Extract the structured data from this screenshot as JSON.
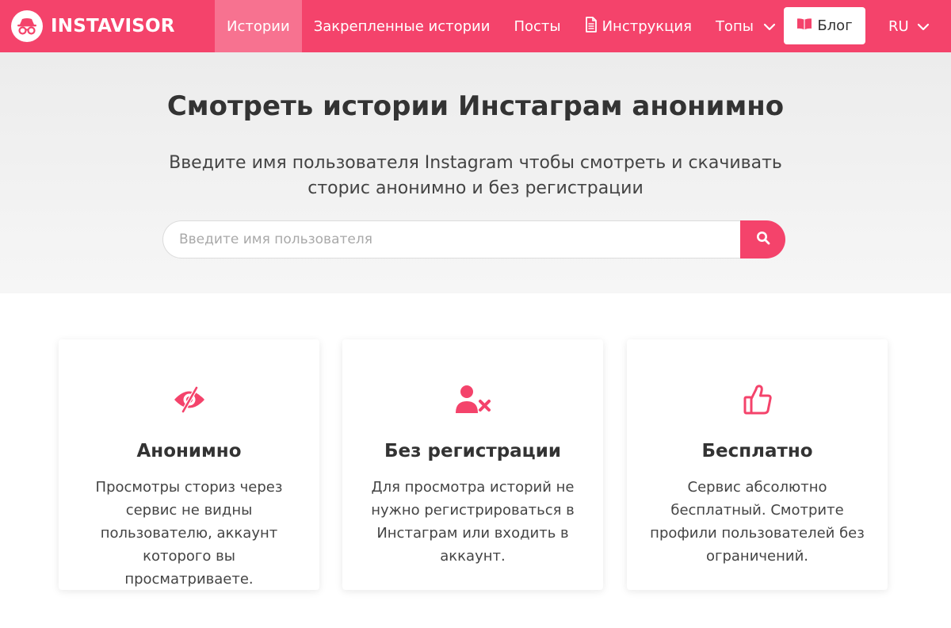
{
  "colors": {
    "brand": "#f4436b",
    "hero_bg": "#efefef",
    "text": "#333333"
  },
  "brand": {
    "name": "INSTAVISOR",
    "logo_icon": "incognito-icon"
  },
  "nav": {
    "items": [
      {
        "label": "Истории",
        "active": true
      },
      {
        "label": "Закрепленные истории"
      },
      {
        "label": "Посты"
      },
      {
        "label": "Инструкция",
        "icon": "document-icon"
      },
      {
        "label": "Топы",
        "icon": "chevron-down-icon"
      }
    ],
    "blog_label": "Блог",
    "blog_icon": "book-icon",
    "language": "RU"
  },
  "hero": {
    "title": "Смотреть истории Инстаграм анонимно",
    "subtitle_line1": "Введите имя пользователя Instagram чтобы смотреть и скачивать",
    "subtitle_line2": "сторис анонимно и без регистрации",
    "search_placeholder": "Введите имя пользователя",
    "search_icon": "search-icon"
  },
  "features": [
    {
      "icon": "eye-slash-icon",
      "title": "Анонимно",
      "text": "Просмотры сториз через сервис не видны пользователю, аккаунт которого вы просматриваете."
    },
    {
      "icon": "user-times-icon",
      "title": "Без регистрации",
      "text": "Для просмотра историй не нужно регистрироваться в Инстаграм или входить в аккаунт."
    },
    {
      "icon": "thumbs-up-icon",
      "title": "Бесплатно",
      "text": "Сервис абсолютно бесплатный. Смотрите профили пользователей без ограничений."
    }
  ]
}
